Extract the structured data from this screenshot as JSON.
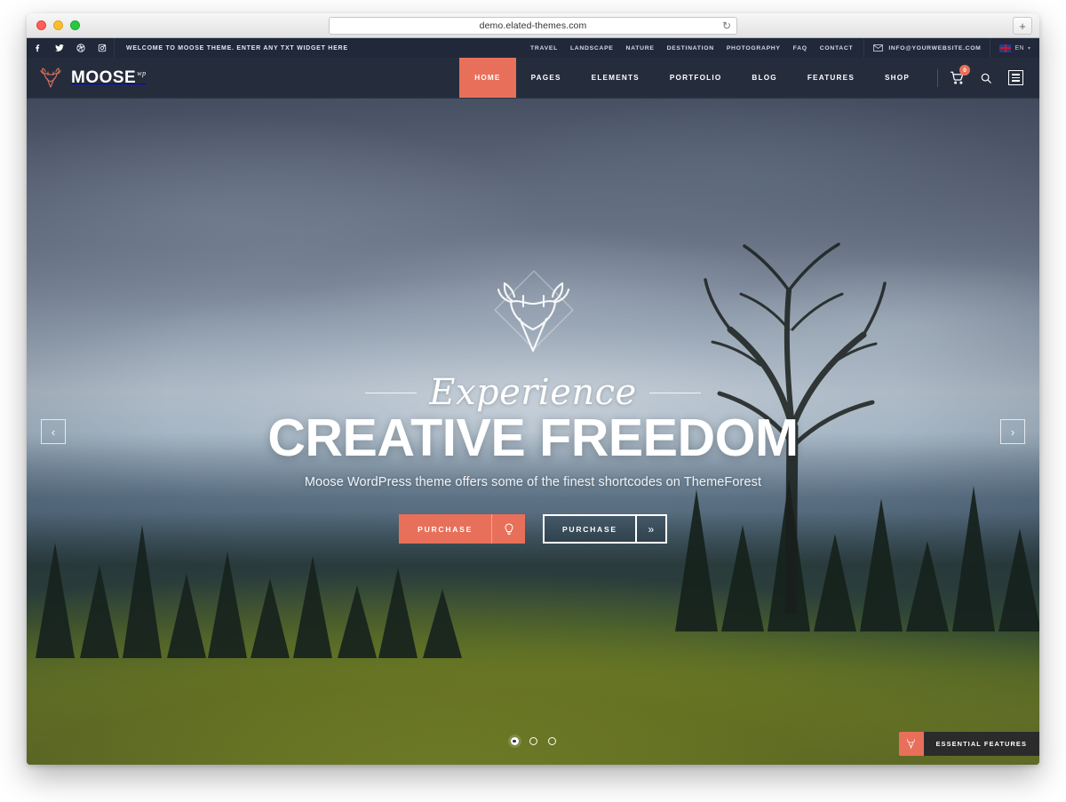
{
  "browser": {
    "url": "demo.elated-themes.com",
    "reload_icon": "reload-icon",
    "newtab_label": "+",
    "traffic_lights": [
      "close",
      "minimize",
      "maximize"
    ]
  },
  "topbar": {
    "social": [
      {
        "name": "facebook-icon",
        "label": "f"
      },
      {
        "name": "twitter-icon",
        "label": "t"
      },
      {
        "name": "dribbble-icon",
        "label": "d"
      },
      {
        "name": "instagram-icon",
        "label": "i"
      }
    ],
    "welcome": "WELCOME TO MOOSE THEME. ENTER ANY TXT WIDGET HERE",
    "links": [
      "TRAVEL",
      "LANDSCAPE",
      "NATURE",
      "DESTINATION",
      "PHOTOGRAPHY",
      "FAQ",
      "CONTACT"
    ],
    "email": "INFO@YOURWEBSITE.COM",
    "language": "EN",
    "language_caret": "⌄"
  },
  "header": {
    "logo_text": "MOOSE",
    "logo_sup": "wp",
    "nav": [
      {
        "label": "HOME",
        "active": true
      },
      {
        "label": "PAGES",
        "active": false
      },
      {
        "label": "ELEMENTS",
        "active": false
      },
      {
        "label": "PORTFOLIO",
        "active": false
      },
      {
        "label": "BLOG",
        "active": false
      },
      {
        "label": "FEATURES",
        "active": false
      },
      {
        "label": "SHOP",
        "active": false
      }
    ],
    "cart_count": "0"
  },
  "hero": {
    "script_title": "Experience",
    "heading": "CREATIVE FREEDOM",
    "subtitle": "Moose WordPress theme offers some of the finest shortcodes on ThemeForest",
    "button_primary": {
      "label": "PURCHASE",
      "icon": "lightbulb-icon"
    },
    "button_secondary": {
      "label": "PURCHASE",
      "icon": "double-chevron-right-icon"
    },
    "arrow_prev": "‹",
    "arrow_next": "›",
    "dots": [
      {
        "active": true
      },
      {
        "active": false
      },
      {
        "active": false
      }
    ]
  },
  "feature_tab": {
    "label": "ESSENTIAL FEATURES",
    "icon": "moose-icon"
  },
  "colors": {
    "accent": "#e8705a",
    "header_bg": "#252d3d",
    "topbar_bg": "#20283a",
    "tab_bg": "#2b2b2b"
  }
}
